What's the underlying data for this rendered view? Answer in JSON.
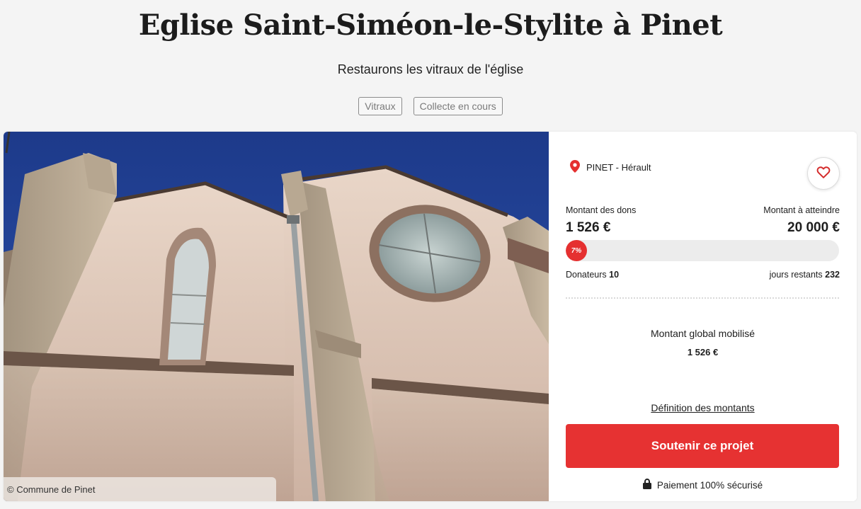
{
  "header": {
    "title": "Eglise Saint-Siméon-le-Stylite à Pinet",
    "subtitle": "Restaurons les vitraux de l'église",
    "tags": [
      "Vitraux",
      "Collecte en cours"
    ]
  },
  "photo": {
    "credit": "© Commune de Pinet",
    "subject": "church-facade-photo"
  },
  "project": {
    "location": "PINET - Hérault",
    "location_icon": "map-pin-icon",
    "favorite_icon": "heart-icon",
    "raised_label": "Montant des dons",
    "raised_value": "1 526 €",
    "goal_label": "Montant à atteindre",
    "goal_value": "20 000 €",
    "progress_label": "7%",
    "progress_fraction": 0.07,
    "donors_label": "Donateurs",
    "donors_value": "10",
    "days_label": "jours restants",
    "days_value": "232",
    "global_label": "Montant global mobilisé",
    "global_value": "1 526 €",
    "definition_link": "Définition des montants",
    "cta_label": "Soutenir ce projet",
    "secure_label": "Paiement 100% sécurisé",
    "secure_icon": "lock-icon"
  },
  "colors": {
    "accent": "#e63232",
    "background": "#f4f4f4",
    "progress_track": "#ececec"
  }
}
